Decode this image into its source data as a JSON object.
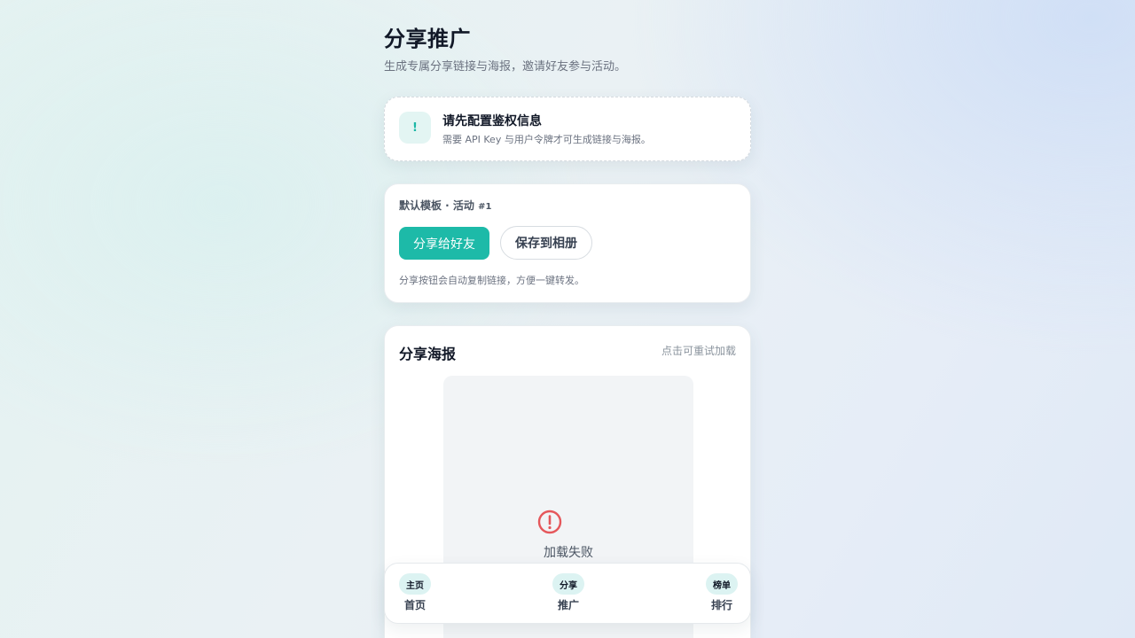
{
  "header": {
    "title": "分享推广",
    "subtitle": "生成专属分享链接与海报，邀请好友参与活动。"
  },
  "notice": {
    "icon_text": "!",
    "icon": "exclamation-icon",
    "title": "请先配置鉴权信息",
    "description": "需要 API Key 与用户令牌才可生成链接与海报。"
  },
  "template": {
    "label": "默认模板 · 活动",
    "activity_number": "#1",
    "share_button": "分享给好友",
    "save_button": "保存到相册",
    "hint": "分享按钮会自动复制链接，方便一键转发。"
  },
  "poster": {
    "title": "分享海报",
    "retry_hint": "点击可重试加载",
    "error_icon": "alert-circle-icon",
    "error_text": "加载失败"
  },
  "bottom_nav": {
    "items": [
      {
        "badge": "主页",
        "label": "首页"
      },
      {
        "badge": "分享",
        "label": "推广"
      },
      {
        "badge": "榜单",
        "label": "排行"
      }
    ]
  },
  "colors": {
    "accent": "#1dbaa8",
    "error": "#e5575b",
    "nav_badge_bg": "#dcf3f2"
  }
}
